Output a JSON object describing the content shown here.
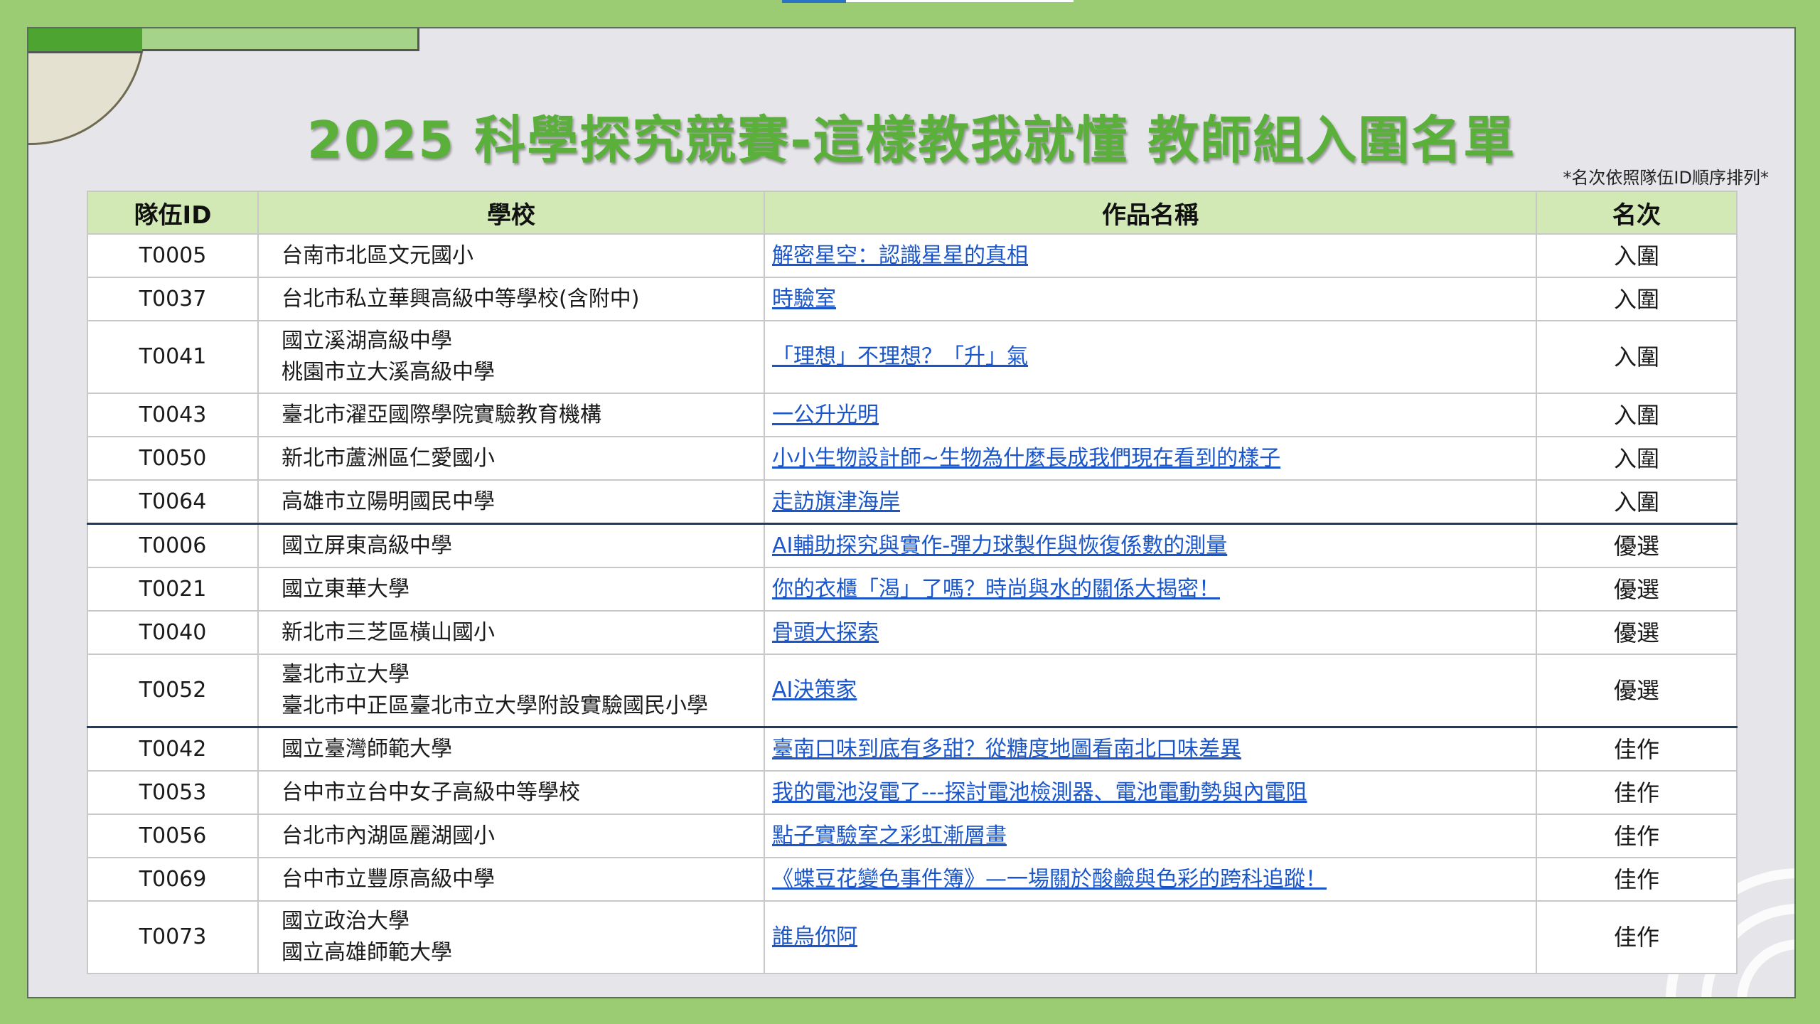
{
  "title": "2025 科學探究競賽-這樣教我就懂 教師組入圍名單",
  "note": "*名次依照隊伍ID順序排列*",
  "table": {
    "headers": [
      "隊伍ID",
      "學校",
      "作品名稱",
      "名次"
    ],
    "rows": [
      {
        "id": "T0005",
        "school": [
          "台南市北區文元國小"
        ],
        "work": "解密星空：認識星星的真相",
        "rank": "入圍"
      },
      {
        "id": "T0037",
        "school": [
          "台北市私立華興高級中等學校(含附中)"
        ],
        "work": "時驗室",
        "rank": "入圍"
      },
      {
        "id": "T0041",
        "school": [
          "國立溪湖高級中學",
          "桃園市立大溪高級中學"
        ],
        "work": "「理想」不理想？「升」氣",
        "rank": "入圍"
      },
      {
        "id": "T0043",
        "school": [
          "臺北市濯亞國際學院實驗教育機構"
        ],
        "work": "一公升光明",
        "rank": "入圍"
      },
      {
        "id": "T0050",
        "school": [
          "新北市蘆洲區仁愛國小"
        ],
        "work": "小小生物設計師~生物為什麼長成我們現在看到的樣子",
        "rank": "入圍"
      },
      {
        "id": "T0064",
        "school": [
          "高雄市立陽明國民中學"
        ],
        "work": "走訪旗津海岸",
        "rank": "入圍"
      },
      {
        "id": "T0006",
        "school": [
          "國立屏東高級中學"
        ],
        "work": "AI輔助探究與實作-彈力球製作與恢復係數的測量",
        "rank": "優選"
      },
      {
        "id": "T0021",
        "school": [
          "國立東華大學"
        ],
        "work": "你的衣櫃「渴」了嗎？時尚與水的關係大揭密！",
        "rank": "優選"
      },
      {
        "id": "T0040",
        "school": [
          "新北市三芝區橫山國小"
        ],
        "work": "骨頭大探索",
        "rank": "優選"
      },
      {
        "id": "T0052",
        "school": [
          "臺北市立大學",
          "臺北市中正區臺北市立大學附設實驗國民小學"
        ],
        "work": "AI決策家",
        "rank": "優選"
      },
      {
        "id": "T0042",
        "school": [
          "國立臺灣師範大學"
        ],
        "work": "臺南口味到底有多甜？從糖度地圖看南北口味差異",
        "rank": "佳作"
      },
      {
        "id": "T0053",
        "school": [
          "台中市立台中女子高級中等學校"
        ],
        "work": "我的電池沒電了---探討電池檢測器、電池電動勢與內電阻",
        "rank": "佳作"
      },
      {
        "id": "T0056",
        "school": [
          "台北市內湖區麗湖國小"
        ],
        "work": "點子實驗室之彩虹漸層畫",
        "rank": "佳作"
      },
      {
        "id": "T0069",
        "school": [
          "台中市立豐原高級中學"
        ],
        "work": "《蝶豆花變色事件簿》—一場關於酸鹼與色彩的跨科追蹤！",
        "rank": "佳作"
      },
      {
        "id": "T0073",
        "school": [
          "國立政治大學",
          "國立高雄師範大學"
        ],
        "work": "誰烏你阿",
        "rank": "佳作"
      }
    ]
  },
  "colors": {
    "title": "#5ab03a",
    "header_bg": "#d3e9b5",
    "link": "#1a56c9",
    "frame": "#9bcb72",
    "slide_bg": "#e6e5e9"
  }
}
